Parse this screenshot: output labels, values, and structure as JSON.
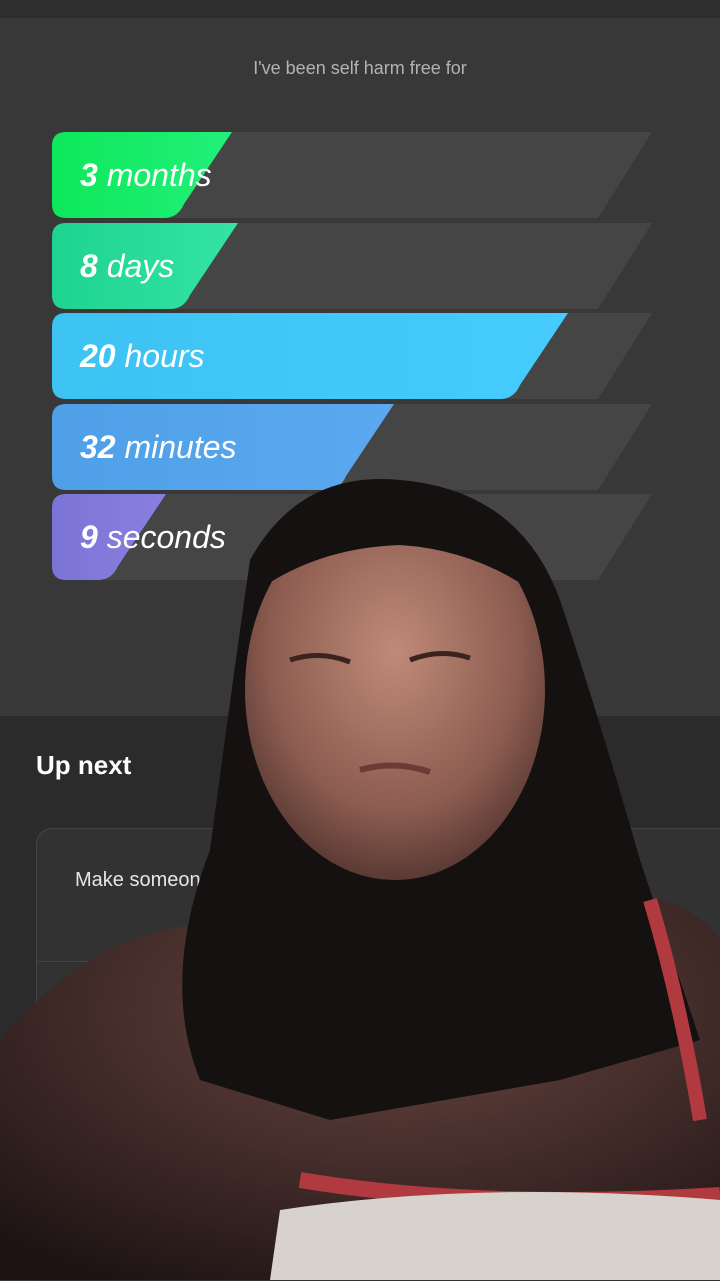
{
  "header": {
    "subtitle": "I've been self harm free for"
  },
  "counters": [
    {
      "value": "3",
      "unit": "months",
      "fill_fraction": 0.3,
      "colors": [
        "#0ee85a",
        "#22f07a"
      ]
    },
    {
      "value": "8",
      "unit": "days",
      "fill_fraction": 0.31,
      "colors": [
        "#1ed38f",
        "#34e4a6"
      ]
    },
    {
      "value": "20",
      "unit": "hours",
      "fill_fraction": 0.86,
      "colors": [
        "#3cc3f2",
        "#46cbff"
      ]
    },
    {
      "value": "32",
      "unit": "minutes",
      "fill_fraction": 0.57,
      "colors": [
        "#4fa0e8",
        "#5aa8f0"
      ]
    },
    {
      "value": "9",
      "unit": "seconds",
      "fill_fraction": 0.19,
      "colors": [
        "#7a74d6",
        "#8a7fe0"
      ]
    }
  ],
  "up_next": {
    "title": "Up next",
    "card_text": "Make someone"
  },
  "colors": {
    "track": "#454545",
    "background": "#383838",
    "panel": "#2b2b2b"
  }
}
